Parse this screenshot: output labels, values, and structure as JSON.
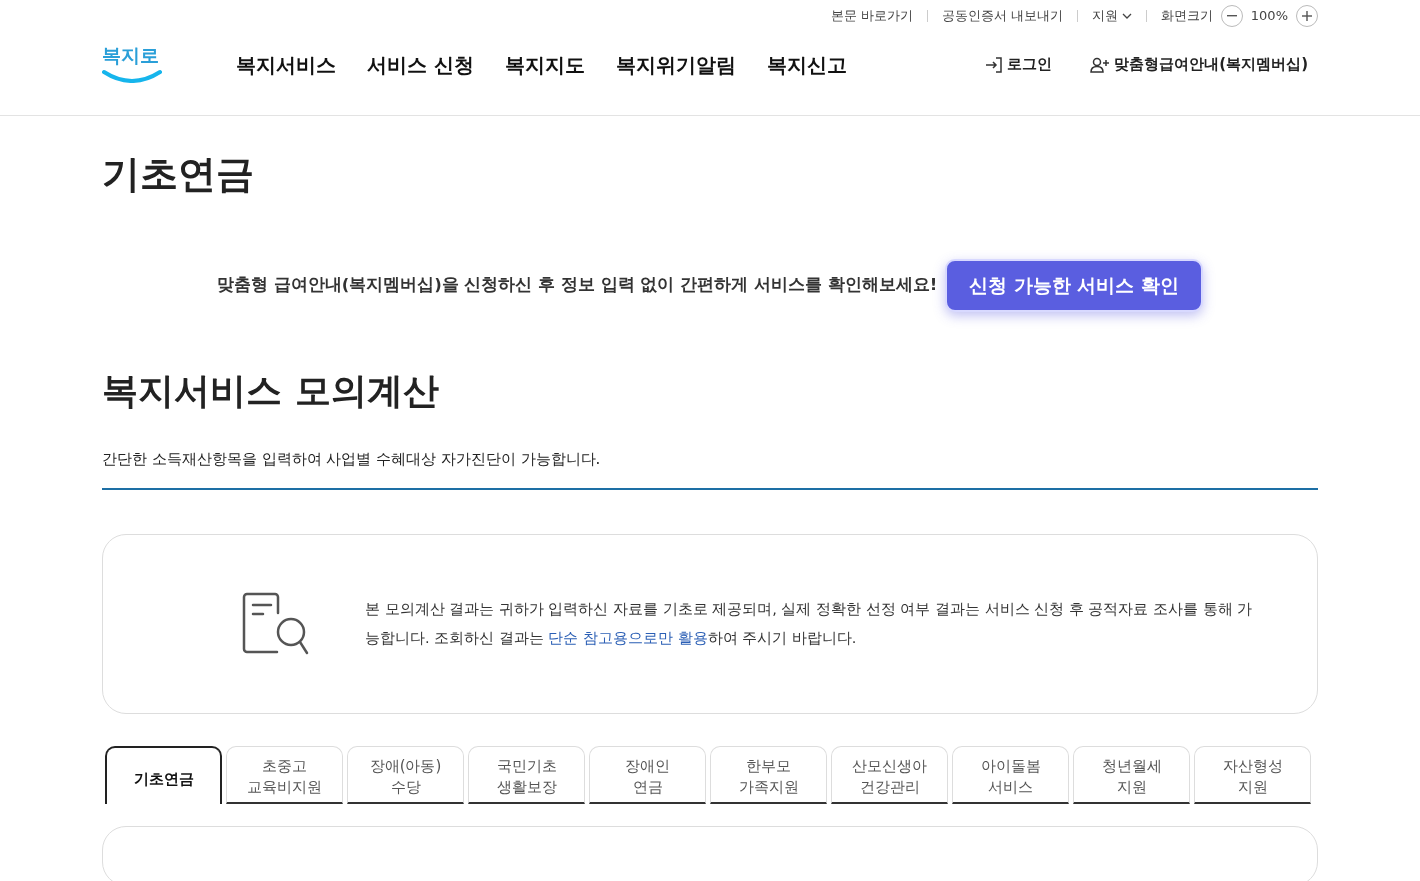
{
  "utility_links": [
    {
      "label": "본문 바로가기",
      "kind": "link"
    },
    {
      "label": "공동인증서 내보내기",
      "kind": "link"
    },
    {
      "label": "지원",
      "kind": "dropdown"
    },
    {
      "label": "화면크기",
      "kind": "text"
    }
  ],
  "zoom": {
    "value": "100%"
  },
  "logo": {
    "text": "복지로"
  },
  "main_nav": [
    {
      "label": "복지서비스"
    },
    {
      "label": "서비스 신청"
    },
    {
      "label": "복지지도"
    },
    {
      "label": "복지위기알림"
    },
    {
      "label": "복지신고"
    }
  ],
  "account_links": [
    {
      "label": "로그인",
      "kind": "login"
    },
    {
      "label": "맞춤형급여안내(복지멤버십)",
      "kind": "member"
    }
  ],
  "page_title": "기초연금",
  "promo": {
    "text": "맞춤형 급여안내(복지멤버십)을 신청하신 후 정보 입력 없이 간편하게 서비스를 확인해보세요!",
    "button": "신청 가능한 서비스 확인"
  },
  "section": {
    "title": "복지서비스 모의계산",
    "description": "간단한 소득재산항목을 입력하여 사업별 수혜대상 자가진단이 가능합니다."
  },
  "notice": {
    "text_before": "본 모의계산 결과는 귀하가 입력하신 자료를 기초로 제공되며, 실제 정확한 선정 여부 결과는 서비스 신청 후 공적자료 조사를 통해 가능합니다. 조회하신 결과는 ",
    "highlight": "단순 참고용으로만 활용",
    "text_after": "하여 주시기 바랍니다."
  },
  "tabs": [
    {
      "lines": [
        "기초연금"
      ],
      "selected": true
    },
    {
      "lines": [
        "초중고",
        "교육비지원"
      ],
      "selected": false
    },
    {
      "lines": [
        "장애(아동)",
        "수당"
      ],
      "selected": false
    },
    {
      "lines": [
        "국민기초",
        "생활보장"
      ],
      "selected": false
    },
    {
      "lines": [
        "장애인",
        "연금"
      ],
      "selected": false
    },
    {
      "lines": [
        "한부모",
        "가족지원"
      ],
      "selected": false
    },
    {
      "lines": [
        "산모신생아",
        "건강관리"
      ],
      "selected": false
    },
    {
      "lines": [
        "아이돌봄",
        "서비스"
      ],
      "selected": false
    },
    {
      "lines": [
        "청년월세",
        "지원"
      ],
      "selected": false
    },
    {
      "lines": [
        "자산형성",
        "지원"
      ],
      "selected": false
    }
  ]
}
